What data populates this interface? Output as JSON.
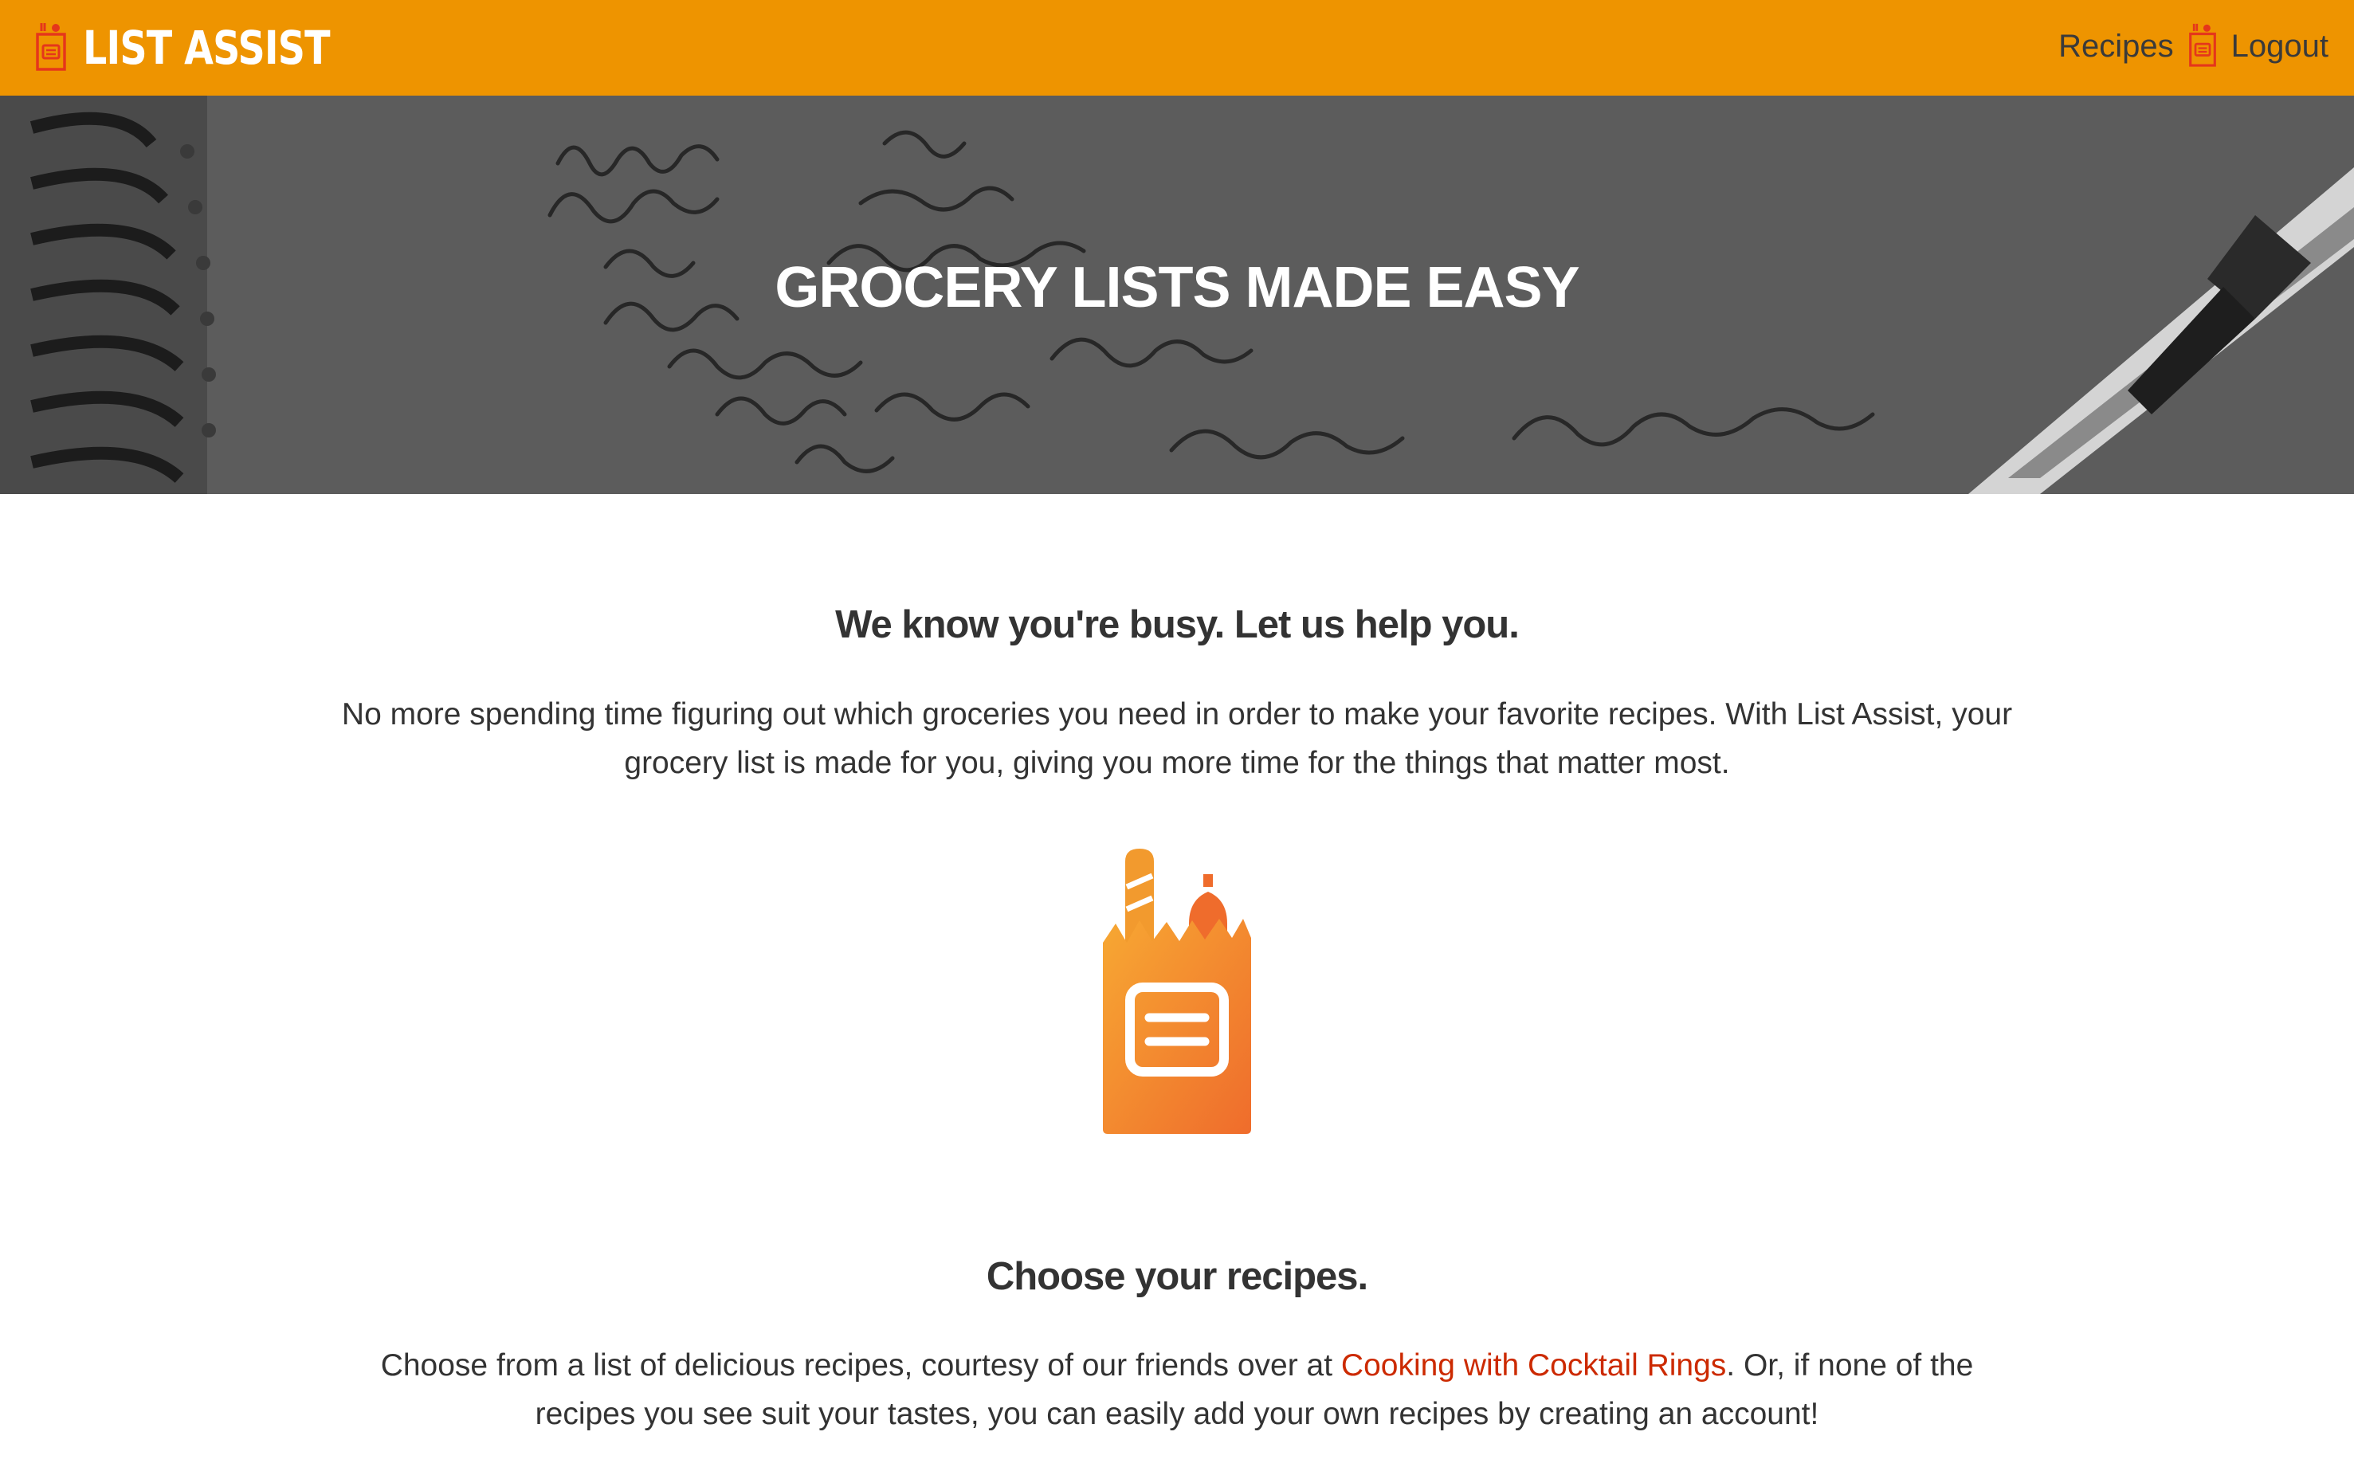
{
  "brand": {
    "name": "LIST ASSIST",
    "icon": "grocery-bag-icon"
  },
  "nav": {
    "recipes_label": "Recipes",
    "logout_label": "Logout",
    "divider_icon": "grocery-bag-icon"
  },
  "hero": {
    "title": "GROCERY LISTS MADE EASY",
    "background": "handwritten-grocery-list-notebook-photo"
  },
  "intro": {
    "heading": "We know you're busy. Let us help you.",
    "body": "No more spending time figuring out which groceries you need in order to make your favorite recipes. With List Assist, your grocery list is made for you, giving you more time for the things that matter most."
  },
  "feature_icon": "grocery-bag-icon",
  "choose": {
    "heading": "Choose your recipes.",
    "body_before": "Choose from a list of delicious recipes, courtesy of our friends over at ",
    "link_text": "Cooking with Cocktail Rings",
    "body_after": ". Or, if none of the recipes you see suit your tastes, you can easily add your own recipes by creating an account!"
  },
  "colors": {
    "navbar": "#ee9400",
    "link": "#cc2a00",
    "bag_gradient_start": "#f7a833",
    "bag_gradient_end": "#ef6c2c"
  }
}
